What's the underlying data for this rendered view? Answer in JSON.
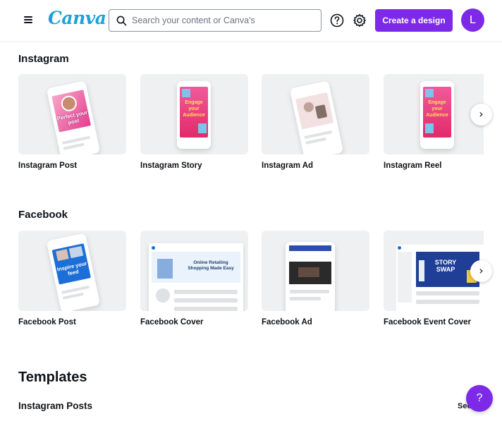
{
  "header": {
    "menu_icon": "hamburger-menu-icon",
    "logo": "Canva",
    "search_placeholder": "Search your content or Canva's",
    "help_icon": "question-circle-icon",
    "settings_icon": "gear-icon",
    "create_button": "Create a design",
    "avatar_initial": "L"
  },
  "instagram": {
    "title": "Instagram",
    "cards": [
      {
        "label": "Instagram Post",
        "thumb_text": "Perfect your post"
      },
      {
        "label": "Instagram Story",
        "thumb_text": "Engage your Audience"
      },
      {
        "label": "Instagram Ad",
        "thumb_text": ""
      },
      {
        "label": "Instagram Reel",
        "thumb_text": "Engage your Audience"
      }
    ],
    "next_icon": "chevron-right-icon"
  },
  "facebook": {
    "title": "Facebook",
    "cards": [
      {
        "label": "Facebook Post",
        "thumb_text": "Inspire your feed"
      },
      {
        "label": "Facebook Cover",
        "thumb_text": "Online Retailing Shopping Made Easy"
      },
      {
        "label": "Facebook Ad",
        "thumb_text": ""
      },
      {
        "label": "Facebook Event Cover",
        "thumb_text": "STORY SWAP"
      }
    ],
    "next_icon": "chevron-right-icon"
  },
  "templates": {
    "title": "Templates",
    "subtitle": "Instagram Posts",
    "see_all": "See"
  },
  "help_fab": "?",
  "colors": {
    "brand_purple": "#7d2ae8",
    "logo_blue": "#1aa3d9",
    "thumb_bg": "#eff0f2"
  }
}
